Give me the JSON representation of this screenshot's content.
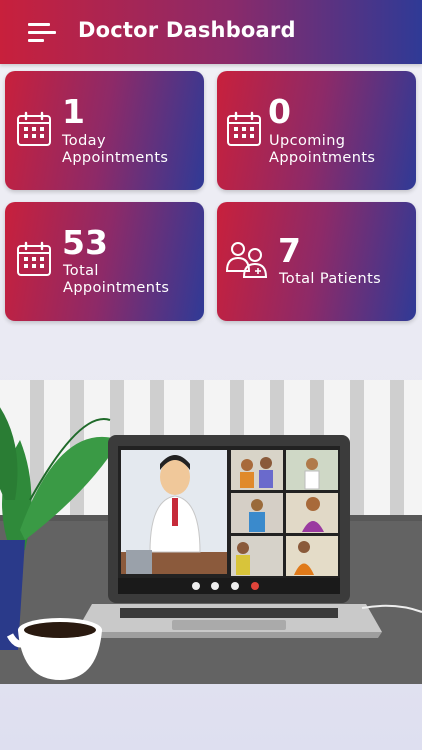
{
  "header": {
    "title": "Doctor Dashboard",
    "menu_icon": "hamburger-menu-icon"
  },
  "cards": [
    {
      "value": "1",
      "label": "Today\nAppointments",
      "icon": "calendar-icon"
    },
    {
      "value": "0",
      "label": "Upcoming\nAppointments",
      "icon": "calendar-icon"
    },
    {
      "value": "53",
      "label": "Total\nAppointments",
      "icon": "calendar-icon"
    },
    {
      "value": "7",
      "label": "Total Patients",
      "icon": "patients-icon"
    }
  ],
  "colors": {
    "gradient_start": "#c8203c",
    "gradient_mid": "#8d2a68",
    "gradient_end": "#2f3a96"
  },
  "illustration": {
    "subject": "telemedicine-video-call-illustration"
  }
}
